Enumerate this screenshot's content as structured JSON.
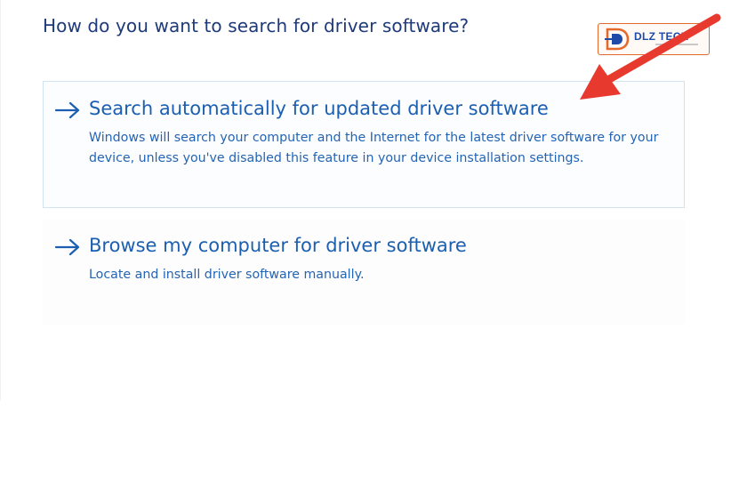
{
  "dialog": {
    "heading": "How do you want to search for driver software?",
    "options": [
      {
        "title": "Search automatically for updated driver software",
        "description": "Windows will search your computer and the Internet for the latest driver software for your device, unless you've disabled this feature in your device installation settings."
      },
      {
        "title": "Browse my computer for driver software",
        "description": "Locate and install driver software manually."
      }
    ]
  },
  "watermark": {
    "brand_letter": "D",
    "brand_text": "DLZ TECH"
  },
  "colors": {
    "heading": "#1f3a78",
    "link": "#1c5fb0",
    "description": "#2464b4",
    "selected_border": "#cfe3f3",
    "annotation_arrow": "#e8392f",
    "logo_orange": "#e36a2c",
    "logo_blue": "#1e4aa8"
  },
  "icons": {
    "option_arrow": "right-arrow-icon",
    "annotation": "red-pointer-arrow",
    "logo": "dlz-tech-logo"
  }
}
